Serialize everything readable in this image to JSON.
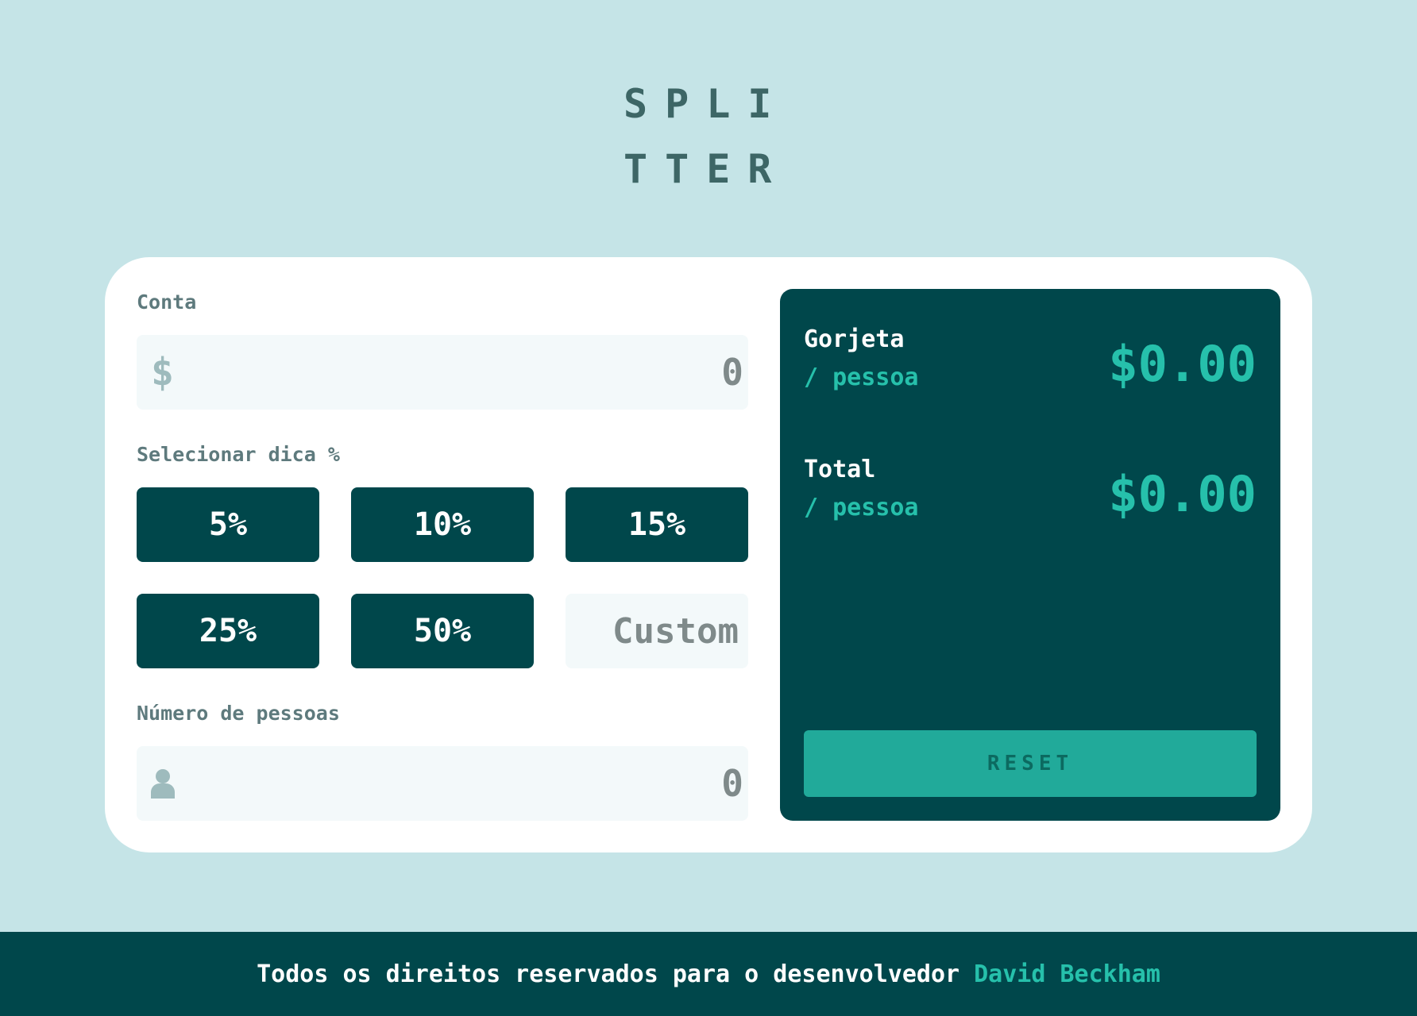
{
  "logo": {
    "line1": "SPLI",
    "line2": "TTER"
  },
  "bill": {
    "label": "Conta",
    "currency_symbol": "$",
    "value": "0"
  },
  "tip": {
    "label": "Selecionar dica %",
    "options": [
      "5%",
      "10%",
      "15%",
      "25%",
      "50%"
    ],
    "custom_placeholder": "Custom"
  },
  "people": {
    "label": "Número de pessoas",
    "value": "0"
  },
  "results": {
    "tip": {
      "title": "Gorjeta",
      "sub": "/ pessoa",
      "amount": "$0.00"
    },
    "total": {
      "title": "Total",
      "sub": "/ pessoa",
      "amount": "$0.00"
    },
    "reset_label": "RESET"
  },
  "footer": {
    "text": "Todos os direitos reservados para o desenvolvedor",
    "author": "David Beckham"
  },
  "colors": {
    "background": "#c5e4e7",
    "dark_cyan": "#00474b",
    "strong_cyan": "#26c0ab",
    "reset_disabled": "#21aa9a"
  },
  "icons": {
    "bill": "dollar-icon",
    "people": "person-icon"
  }
}
